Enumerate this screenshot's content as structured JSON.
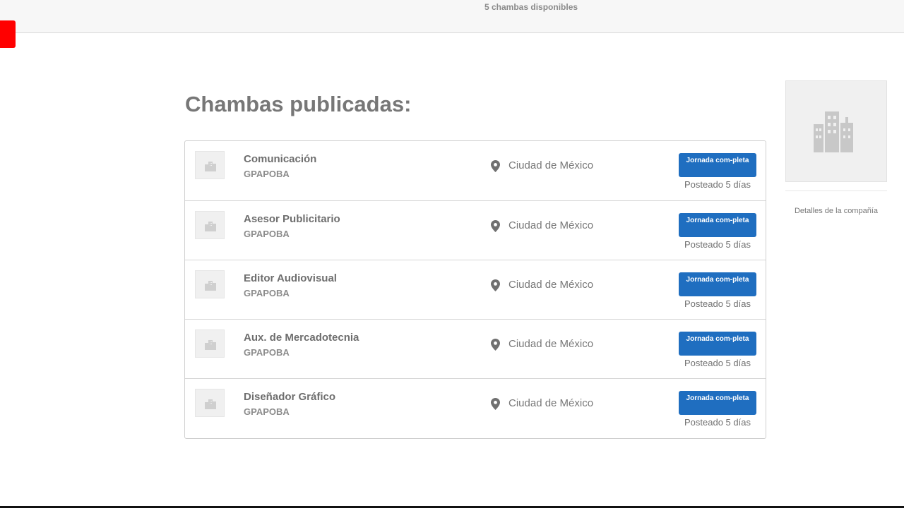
{
  "topbar": {
    "count_text": "5 chambas disponibles"
  },
  "section": {
    "title": "Chambas publicadas:"
  },
  "jobs": [
    {
      "title": "Comunicación",
      "company": "GPAPOBA",
      "location": "Ciudad de México",
      "badge": "Jornada com-pleta",
      "posted": "Posteado 5 días"
    },
    {
      "title": "Asesor Publicitario",
      "company": "GPAPOBA",
      "location": "Ciudad de México",
      "badge": "Jornada com-pleta",
      "posted": "Posteado 5 días"
    },
    {
      "title": "Editor Audiovisual",
      "company": "GPAPOBA",
      "location": "Ciudad de México",
      "badge": "Jornada com-pleta",
      "posted": "Posteado 5 días"
    },
    {
      "title": "Aux. de Mercadotecnia",
      "company": "GPAPOBA",
      "location": "Ciudad de México",
      "badge": "Jornada com-pleta",
      "posted": "Posteado 5 días"
    },
    {
      "title": "Diseñador Gráfico",
      "company": "GPAPOBA",
      "location": "Ciudad de México",
      "badge": "Jornada com-pleta",
      "posted": "Posteado 5 días"
    }
  ],
  "sidebar": {
    "details_link": "Detalles de la compañía"
  },
  "icons": {
    "thumb": "building-icon",
    "location": "map-pin-icon",
    "company_logo": "building-icon"
  },
  "colors": {
    "badge": "#1f6ec0",
    "red_tab": "#ff0000"
  }
}
